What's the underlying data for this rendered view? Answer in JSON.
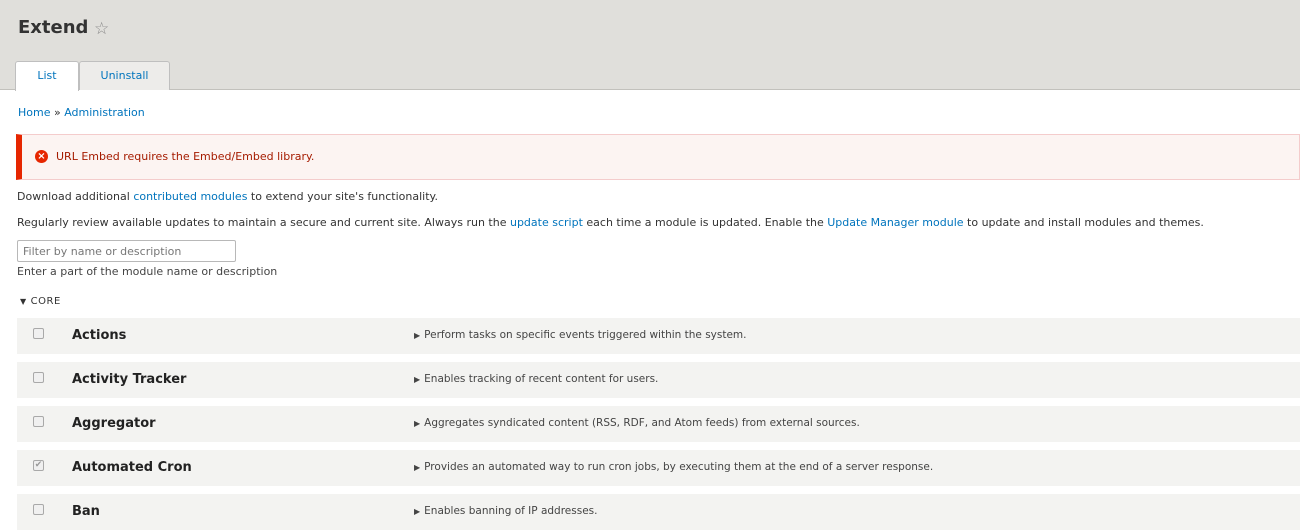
{
  "header": {
    "title": "Extend",
    "star_icon": "☆",
    "tabs": [
      {
        "label": "List"
      },
      {
        "label": "Uninstall"
      }
    ]
  },
  "breadcrumb": {
    "home": "Home",
    "separator": "»",
    "admin": "Administration"
  },
  "message": {
    "icon": "×",
    "text": "URL Embed requires the Embed/Embed library."
  },
  "intro": {
    "p1_before": "Download additional ",
    "p1_link": "contributed modules",
    "p1_after": " to extend your site's functionality.",
    "p2_part1": "Regularly review available updates to maintain a secure and current site. Always run the ",
    "p2_link1": "update script",
    "p2_part2": " each time a module is updated. Enable the ",
    "p2_link2": "Update Manager module",
    "p2_part3": " to update and install modules and themes."
  },
  "filter": {
    "placeholder": "Filter by name or description",
    "value": "",
    "description": "Enter a part of the module name or description"
  },
  "section": {
    "arrow": "▼",
    "label": "CORE"
  },
  "modules": [
    {
      "name": "Actions",
      "checked": false,
      "description": "Perform tasks on specific events triggered within the system."
    },
    {
      "name": "Activity Tracker",
      "checked": false,
      "description": "Enables tracking of recent content for users."
    },
    {
      "name": "Aggregator",
      "checked": false,
      "description": "Aggregates syndicated content (RSS, RDF, and Atom feeds) from external sources."
    },
    {
      "name": "Automated Cron",
      "checked": true,
      "description": "Provides an automated way to run cron jobs, by executing them at the end of a server response."
    },
    {
      "name": "Ban",
      "checked": false,
      "description": "Enables banning of IP addresses."
    }
  ],
  "glyphs": {
    "checkmark": "✔",
    "expand": "▶"
  },
  "colors": {
    "header_bg": "#e0dfdb",
    "link": "#0074bd",
    "error_accent": "#e62600",
    "error_text": "#a51b00",
    "error_bg": "#fcf4f2",
    "row_bg": "#f3f3f1"
  }
}
